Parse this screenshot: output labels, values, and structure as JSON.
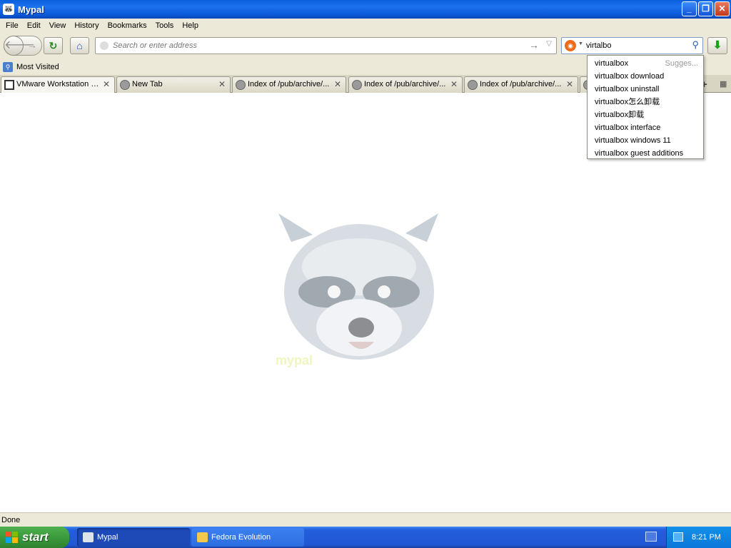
{
  "window": {
    "title": "Mypal",
    "buttons": {
      "minimize": "_",
      "restore": "❐",
      "close": "✕"
    }
  },
  "menu": [
    "File",
    "Edit",
    "View",
    "History",
    "Bookmarks",
    "Tools",
    "Help"
  ],
  "navbar": {
    "address_placeholder": "Search or enter address",
    "search_value": "virtalbo"
  },
  "bookmarks": {
    "most_visited": "Most Visited"
  },
  "tabs": [
    {
      "label": "VMware Workstation 5...",
      "icon": "vmware-icon"
    },
    {
      "label": "New Tab",
      "icon": "globe-icon"
    },
    {
      "label": "Index of /pub/archive/...",
      "icon": "globe-icon"
    },
    {
      "label": "Index of /pub/archive/...",
      "icon": "globe-icon"
    },
    {
      "label": "Index of /pub/archive/...",
      "icon": "globe-icon"
    }
  ],
  "suggestions": {
    "hint": "Sugges...",
    "items": [
      "virtualbox",
      "virtualbox download",
      "virtualbox uninstall",
      "virtualbox怎么卸载",
      "virtualbox卸载",
      "virtualbox interface",
      "virtualbox windows 11",
      "virtualbox guest additions"
    ]
  },
  "logo_text": "mypal",
  "status": "Done",
  "taskbar": {
    "start": "start",
    "tasks": [
      "Mypal",
      "Fedora Evolution"
    ],
    "clock": "8:21 PM"
  },
  "colors": {
    "title_blue": "#0a5fdc",
    "chrome": "#ece9d8",
    "start_green": "#3c9a3c",
    "taskbar_blue": "#245edb"
  }
}
